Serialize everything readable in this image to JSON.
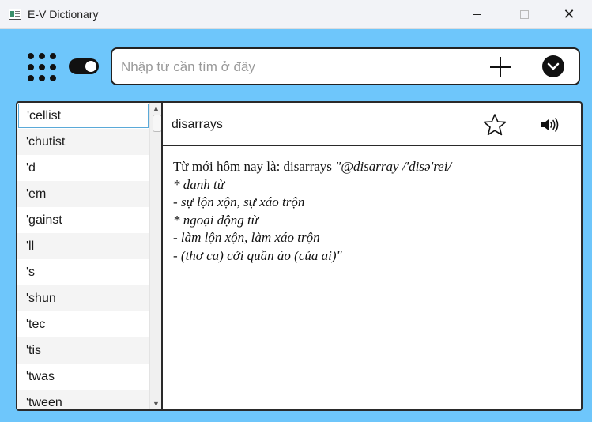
{
  "window": {
    "title": "E-V Dictionary",
    "minimize_glyph": "—",
    "maximize_glyph": "□",
    "close_glyph": "✕"
  },
  "toolbar": {
    "menu_icon": "grid-nine-dots-icon",
    "toggle_icon": "toggle-switch-icon",
    "toggle_on": true,
    "add_icon": "plus-icon",
    "dropdown_icon": "chevron-down-circle-icon"
  },
  "search": {
    "placeholder": "Nhập từ cần tìm ở đây",
    "value": ""
  },
  "word_list": {
    "items": [
      "'cellist",
      "'chutist",
      "'d",
      "'em",
      "'gainst",
      "'ll",
      "'s",
      "'shun",
      "'tec",
      "'tis",
      "'twas",
      "'tween"
    ],
    "selected": "'cellist"
  },
  "detail": {
    "word": "disarrays",
    "star_icon": "star-outline-icon",
    "speaker_icon": "speaker-volume-icon",
    "lines": [
      {
        "lead": "Từ mới hôm nay là: disarrays ",
        "text": "\"@disarray /'disə'rei/"
      },
      {
        "lead": "",
        "text": "* danh từ"
      },
      {
        "lead": "",
        "text": "- sự lộn xộn, sự xáo trộn"
      },
      {
        "lead": "",
        "text": "* ngoại động từ"
      },
      {
        "lead": "",
        "text": "- làm lộn xộn, làm xáo trộn"
      },
      {
        "lead": "",
        "text": "- (thơ ca) cởi quần áo (của ai)\""
      }
    ]
  },
  "colors": {
    "background": "#6ec6fb",
    "titlebar": "#f2f3f7",
    "panel": "#ffffff",
    "border": "#2a2a2a",
    "selection_border": "#5aa9d8"
  }
}
